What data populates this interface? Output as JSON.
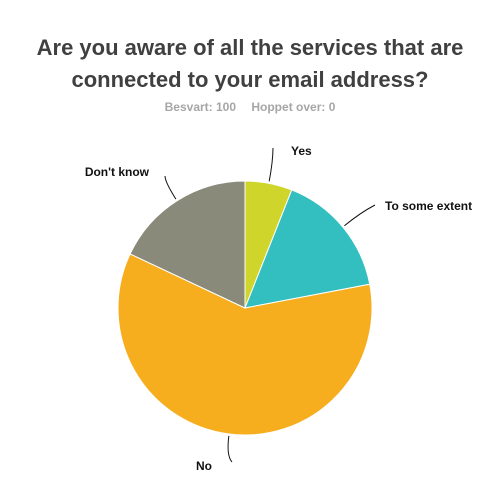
{
  "title_lines": [
    "Are you aware of all the services that are",
    "connected to your email address?"
  ],
  "stats": {
    "answered": "Besvart: 100",
    "skipped": "Hoppet over: 0"
  },
  "chart_data": {
    "type": "pie",
    "categories": [
      "Yes",
      "To some extent",
      "No",
      "Don't know"
    ],
    "values": [
      6,
      16,
      60,
      18
    ],
    "colors": [
      "#cfd52a",
      "#33bfc0",
      "#f6ae1f",
      "#8a8a7a"
    ],
    "start": "top, clockwise"
  }
}
